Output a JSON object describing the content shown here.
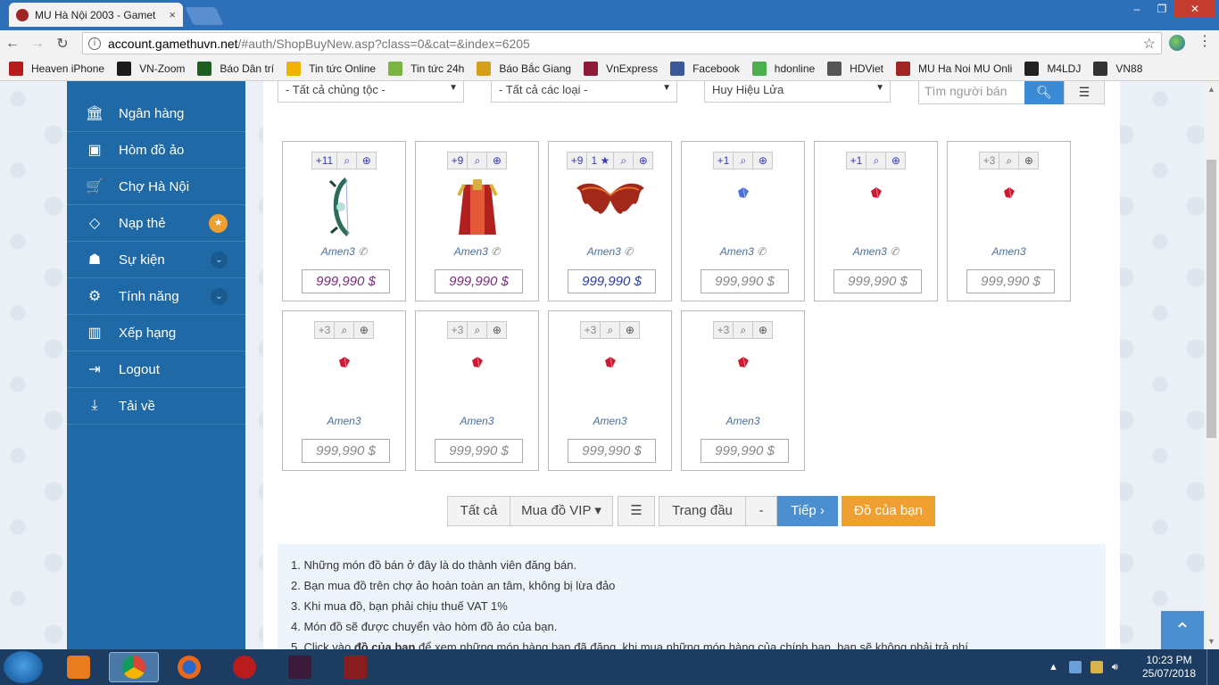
{
  "browser": {
    "tab_title": "MU Hà Nội 2003 - Gamet",
    "tab_close": "×",
    "url_host": "account.gamethuvn.net",
    "url_path": "/#auth/ShopBuyNew.asp?class=0&cat=&index=6205",
    "window_controls": [
      "–",
      "❐",
      "✕"
    ],
    "bookmarks": [
      {
        "label": "Heaven iPhone",
        "color": "#b71c1c"
      },
      {
        "label": "VN-Zoom",
        "color": "#1b1b1b"
      },
      {
        "label": "Báo Dân trí",
        "color": "#1e5e20"
      },
      {
        "label": "Tin tức Online",
        "color": "#f0b400"
      },
      {
        "label": "Tin tức 24h",
        "color": "#7cb342"
      },
      {
        "label": "Báo Bắc Giang",
        "color": "#d4a017"
      },
      {
        "label": "VnExpress",
        "color": "#8e1b3a"
      },
      {
        "label": "Facebook",
        "color": "#3b5998"
      },
      {
        "label": "hdonline",
        "color": "#4caf50"
      },
      {
        "label": "HDViet",
        "color": "#555555"
      },
      {
        "label": "MU Ha Noi MU Onli",
        "color": "#a02424"
      },
      {
        "label": "M4LDJ",
        "color": "#222222"
      },
      {
        "label": "VN88",
        "color": "#333333"
      }
    ]
  },
  "sidebar": {
    "items": [
      {
        "label": "Ngân hàng",
        "icon": "bank-icon",
        "glyph": "🏛",
        "extra": ""
      },
      {
        "label": "Hòm đồ ảo",
        "icon": "briefcase-icon",
        "glyph": "▣",
        "extra": ""
      },
      {
        "label": "Chợ Hà Nội",
        "icon": "cart-icon",
        "glyph": "🛒",
        "extra": ""
      },
      {
        "label": "Nạp thẻ",
        "icon": "diamond-icon",
        "glyph": "◇",
        "extra": "star"
      },
      {
        "label": "Sự kiện",
        "icon": "android-icon",
        "glyph": "☗",
        "extra": "chevron"
      },
      {
        "label": "Tính năng",
        "icon": "cogs-icon",
        "glyph": "⚙",
        "extra": "chevron"
      },
      {
        "label": "Xếp hạng",
        "icon": "bar-chart-icon",
        "glyph": "▥",
        "extra": ""
      },
      {
        "label": "Logout",
        "icon": "sign-out-icon",
        "glyph": "⇥",
        "extra": ""
      },
      {
        "label": "Tải về",
        "icon": "download-icon",
        "glyph": "⤓",
        "extra": ""
      }
    ]
  },
  "filters": {
    "race": "- Tất cả chủng tộc -",
    "type": "- Tất cả các loại -",
    "category": "Huy Hiệu Lửa",
    "seller_placeholder": "Tìm người bán"
  },
  "items": [
    {
      "level": "+11",
      "extra": "",
      "art": "bow",
      "seller": "Amen3",
      "phone": true,
      "price": "999,990 $",
      "price_color": "#7a2a7a"
    },
    {
      "level": "+9",
      "extra": "",
      "art": "armor",
      "seller": "Amen3",
      "phone": true,
      "price": "999,990 $",
      "price_color": "#7a2a7a"
    },
    {
      "level": "+9",
      "extra": "1",
      "art": "wings",
      "seller": "Amen3",
      "phone": true,
      "price": "999,990 $",
      "price_color": "#2a3aa8"
    },
    {
      "level": "+1",
      "extra": "",
      "art": "gem-blue",
      "seller": "Amen3",
      "phone": true,
      "price": "999,990 $",
      "price_color": "#888888"
    },
    {
      "level": "+1",
      "extra": "",
      "art": "gem-red",
      "seller": "Amen3",
      "phone": true,
      "price": "999,990 $",
      "price_color": "#888888"
    },
    {
      "level": "+3",
      "extra": "",
      "art": "gem-red",
      "seller": "Amen3",
      "phone": false,
      "price": "999,990 $",
      "price_color": "#888888"
    },
    {
      "level": "+3",
      "extra": "",
      "art": "gem-red",
      "seller": "Amen3",
      "phone": false,
      "price": "999,990 $",
      "price_color": "#888888"
    },
    {
      "level": "+3",
      "extra": "",
      "art": "gem-red",
      "seller": "Amen3",
      "phone": false,
      "price": "999,990 $",
      "price_color": "#888888"
    },
    {
      "level": "+3",
      "extra": "",
      "art": "gem-red",
      "seller": "Amen3",
      "phone": false,
      "price": "999,990 $",
      "price_color": "#888888"
    },
    {
      "level": "+3",
      "extra": "",
      "art": "gem-red",
      "seller": "Amen3",
      "phone": false,
      "price": "999,990 $",
      "price_color": "#888888"
    }
  ],
  "pager": {
    "all": "Tất cả",
    "vip": "Mua đồ VIP ▾",
    "first": "Trang đầu",
    "dash": "-",
    "next": "Tiếp ›",
    "mine": "Đồ của bạn"
  },
  "notes": [
    "1. Những món đồ bán ở đây là do thành viên đăng bán.",
    "2. Bạn mua đồ trên chợ ảo hoàn toàn an tâm, không bị lừa đảo",
    "3. Khi mua đồ, bạn phải chịu thuế VAT 1%",
    "4. Món đồ sẽ được chuyển vào hòm đồ ảo của bạn."
  ],
  "note5": {
    "before": "5. Click vào ",
    "bold": "đồ của bạn",
    "after": " để xem những món hàng bạn đã đăng, khi mua những món hàng của chính bạn, bạn sẽ không phải trả phí."
  },
  "taskbar": {
    "time": "10:23 PM",
    "date": "25/07/2018"
  },
  "colors": {
    "sidebar": "#1f69a6",
    "accent_blue": "#3b8ad4",
    "accent_orange": "#f0a030"
  }
}
